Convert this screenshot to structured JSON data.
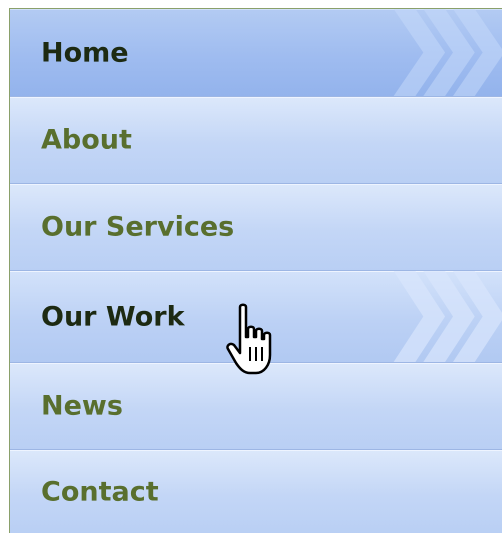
{
  "menu": {
    "items": [
      {
        "label": "Home",
        "state": "active"
      },
      {
        "label": "About",
        "state": "normal"
      },
      {
        "label": "Our Services",
        "state": "normal"
      },
      {
        "label": "Our Work",
        "state": "hover"
      },
      {
        "label": "News",
        "state": "normal"
      },
      {
        "label": "Contact",
        "state": "normal"
      }
    ]
  },
  "colors": {
    "label_normal": "#596f2e",
    "label_active": "#1d2a12",
    "item_bg": "#c3d6f6",
    "item_bg_active": "#9fbcf0",
    "divider": "#9db6e4",
    "border": "#8aa06a"
  },
  "icons": {
    "active_marker": "chevron-arrows-icon",
    "pointer": "hand-pointer-cursor-icon"
  }
}
